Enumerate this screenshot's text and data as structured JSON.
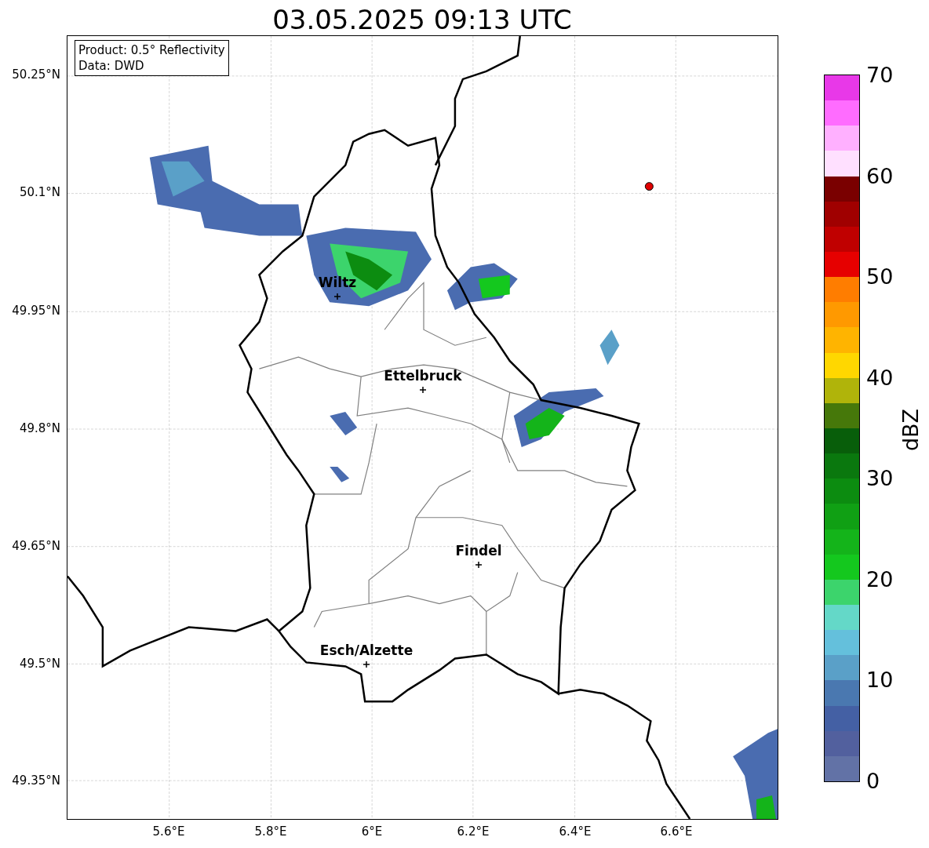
{
  "title": "03.05.2025 09:13 UTC",
  "info_box": [
    "Product: 0.5° Reflectivity",
    "Data: DWD"
  ],
  "map": {
    "y_ticks": [
      "50.25°N",
      "50.1°N",
      "49.95°N",
      "49.8°N",
      "49.65°N",
      "49.5°N",
      "49.35°N"
    ],
    "x_ticks": [
      "5.6°E",
      "5.8°E",
      "6°E",
      "6.2°E",
      "6.4°E",
      "6.6°E"
    ],
    "cities": [
      {
        "name": "Wiltz"
      },
      {
        "name": "Ettelbruck"
      },
      {
        "name": "Findel"
      },
      {
        "name": "Esch/Alzette"
      }
    ]
  },
  "colorbar": {
    "label": "dBZ",
    "ticks": [
      "70",
      "60",
      "50",
      "40",
      "30",
      "20",
      "10",
      "0"
    ],
    "segments": [
      {
        "color": "#e838e8"
      },
      {
        "color": "#ff6cff"
      },
      {
        "color": "#ffb0ff"
      },
      {
        "color": "#ffe0ff"
      },
      {
        "color": "#7a0000"
      },
      {
        "color": "#a00000"
      },
      {
        "color": "#c00000"
      },
      {
        "color": "#e60000"
      },
      {
        "color": "#ff7d00"
      },
      {
        "color": "#ff9900"
      },
      {
        "color": "#ffb400"
      },
      {
        "color": "#ffd700"
      },
      {
        "color": "#b0b40a"
      },
      {
        "color": "#46780a"
      },
      {
        "color": "#085e0a"
      },
      {
        "color": "#0a780e"
      },
      {
        "color": "#0c8c10"
      },
      {
        "color": "#10a014"
      },
      {
        "color": "#14b41a"
      },
      {
        "color": "#14c81e"
      },
      {
        "color": "#3cd46c"
      },
      {
        "color": "#64d8c8"
      },
      {
        "color": "#64c0dc"
      },
      {
        "color": "#5aa0c8"
      },
      {
        "color": "#4a78b0"
      },
      {
        "color": "#4460a4"
      },
      {
        "color": "#52609e"
      },
      {
        "color": "#6272a6"
      }
    ]
  }
}
